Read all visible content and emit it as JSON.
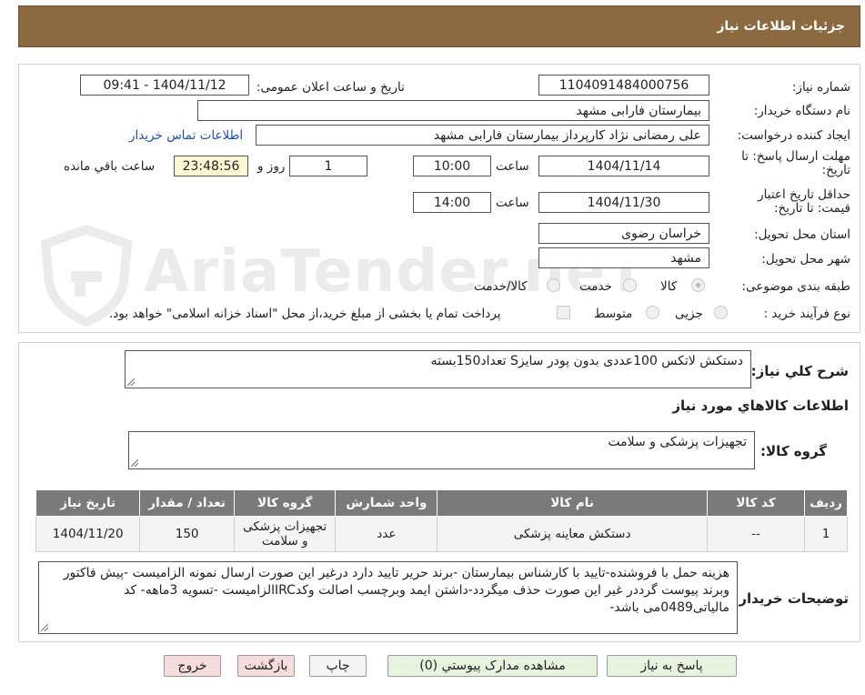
{
  "header": {
    "title": "جزئیات اطلاعات نیاز"
  },
  "watermark": {
    "text": "AriaTender.neT"
  },
  "fields": {
    "need_number_label": "شماره نیاز:",
    "need_number": "1104091484000756",
    "announce_label": "تاریخ و ساعت اعلان عمومی:",
    "announce_value": "1404/11/12 - 09:41",
    "buyer_org_label": "نام دستگاه خریدار:",
    "buyer_org": "بیمارستان فارابی مشهد",
    "requester_label": "ایجاد کننده درخواست:",
    "requester": "علی رمضانی نژاد کارپرداز بیمارستان فارابی مشهد",
    "contact_link": "اطلاعات تماس خریدار",
    "deadline_label": "مهلت ارسال پاسخ: تا تاریخ:",
    "deadline_date": "1404/11/14",
    "time_label": "ساعت",
    "deadline_time": "10:00",
    "days_value": "1",
    "days_label": "روز و",
    "remaining_value": "23:48:56",
    "remaining_label": "ساعت باقي مانده",
    "validity_label": "حداقل تاریخ اعتبار قیمت: تا تاریخ:",
    "validity_date": "1404/11/30",
    "validity_time_label": "ساعت",
    "validity_time": "14:00",
    "province_label": "استان محل تحویل:",
    "province": "خراسان رضوی",
    "city_label": "شهر محل تحویل:",
    "city": "مشهد",
    "category_label": "طبقه بندی موضوعی:",
    "category_options": [
      "کالا",
      "خدمت",
      "کالا/خدمت"
    ],
    "process_label": "نوع فرآیند خرید :",
    "process_options": [
      "جزیی",
      "متوسط"
    ],
    "process_note": "پرداخت تمام یا بخشی از مبلغ خرید،از محل \"اسناد خزانه اسلامی\" خواهد بود."
  },
  "summary": {
    "label": "شرح کلي نياز:",
    "value": "دستکش لاتکس 100عددی بدون پودر سایزS تعداد150بسته"
  },
  "goods_section": {
    "title": "اطلاعات کالاهاي مورد نياز"
  },
  "goods_group": {
    "label": "گروه کالا:",
    "value": "تجهیزات پزشکی و سلامت"
  },
  "table": {
    "headers": [
      "رديف",
      "کد کالا",
      "نام کالا",
      "واحد شمارش",
      "گروه کالا",
      "تعداد / مقدار",
      "تاريخ نياز"
    ],
    "rows": [
      [
        "1",
        "--",
        "دستکش معاینه پزشکی",
        "عدد",
        "تجهیزات پزشکی و سلامت",
        "150",
        "1404/11/20"
      ]
    ]
  },
  "buyer_notes": {
    "label": "توضیحات خریدار:",
    "value": "هزینه حمل با فروشنده-تایید با کارشناس بیمارستان -برند حریر تایید دارد درغیر این صورت ارسال نمونه الزامیست -پیش فاکتور وبرند پیوست گرددر غیر این صورت حذف میگردد-داشتن ایمد وبرچسب اصالت وکدIRCالزامیست -تسویه 3ماهه- کد مالیاتی0489می باشد-"
  },
  "buttons": {
    "reply": "پاسخ به نياز",
    "attachments": "مشاهده مدارک پيوستي (0)",
    "print": "چاپ",
    "back": "بازگشت",
    "exit": "خروج"
  },
  "colors": {
    "header_bg": "#8b6a41",
    "table_header_bg": "#7a7a7a",
    "link": "#1d4fb3",
    "remaining_bg": "#fbf7d3"
  }
}
